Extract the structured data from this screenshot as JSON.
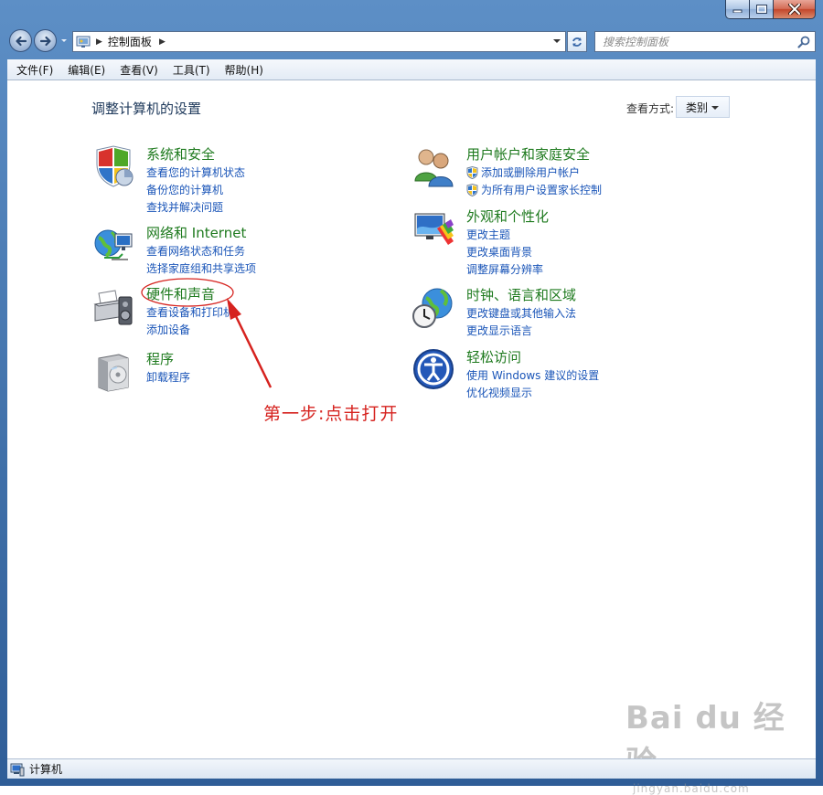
{
  "window": {
    "breadcrumb": "控制面板",
    "search_placeholder": "搜索控制面板"
  },
  "menu": [
    "文件(F)",
    "编辑(E)",
    "查看(V)",
    "工具(T)",
    "帮助(H)"
  ],
  "main": {
    "page_title": "调整计算机的设置",
    "view_by_label": "查看方式:",
    "view_by_value": "类别"
  },
  "categories": [
    {
      "title": "系统和安全",
      "links": [
        "查看您的计算机状态",
        "备份您的计算机",
        "查找并解决问题"
      ]
    },
    {
      "title": "网络和 Internet",
      "links": [
        "查看网络状态和任务",
        "选择家庭组和共享选项"
      ]
    },
    {
      "title": "硬件和声音",
      "links": [
        "查看设备和打印机",
        "添加设备"
      ]
    },
    {
      "title": "程序",
      "links": [
        "卸载程序"
      ]
    },
    {
      "title": "用户帐户和家庭安全",
      "links": [
        "添加或删除用户帐户",
        "为所有用户设置家长控制"
      ]
    },
    {
      "title": "外观和个性化",
      "links": [
        "更改主题",
        "更改桌面背景",
        "调整屏幕分辨率"
      ]
    },
    {
      "title": "时钟、语言和区域",
      "links": [
        "更改键盘或其他输入法",
        "更改显示语言"
      ]
    },
    {
      "title": "轻松访问",
      "links": [
        "使用 Windows 建议的设置",
        "优化视频显示"
      ]
    }
  ],
  "annotation": {
    "text": "第一步:点击打开",
    "color": "#d6231f"
  },
  "watermark": {
    "main": "Bai du 经验",
    "sub": "jingyan.baidu.com"
  },
  "statusbar": {
    "text": "计算机"
  }
}
